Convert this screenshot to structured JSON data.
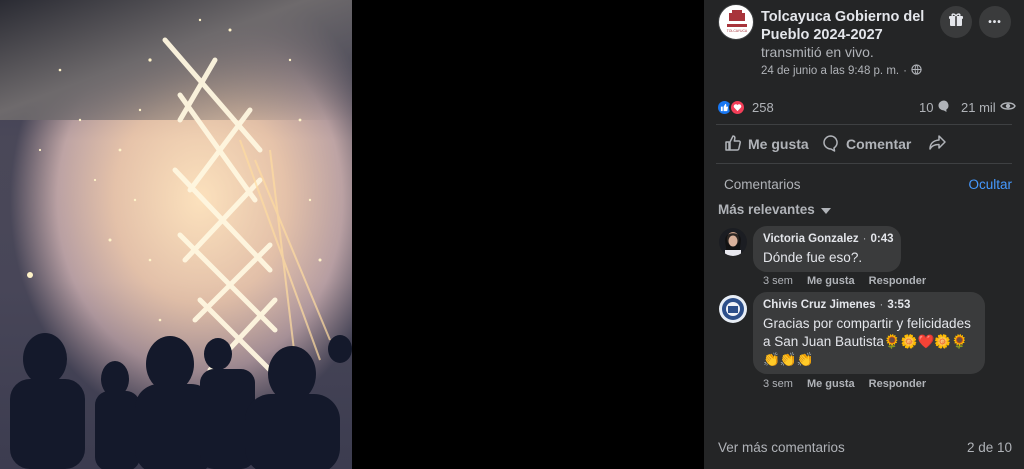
{
  "post": {
    "page_name": "Tolcayuca Gobierno del Pueblo 2024-2027",
    "activity": "transmitió en vivo.",
    "date": "24 de junio a las 9:48 p. m.",
    "meta_separator": "·",
    "privacy_icon": "globe-icon",
    "logo_text": "TOLCAYUCA"
  },
  "header_buttons": [
    {
      "icon": "gift-icon"
    },
    {
      "icon": "more-icon",
      "glyph": "•••"
    }
  ],
  "stats": {
    "reaction_icons": [
      "like-icon",
      "love-icon"
    ],
    "reactions_count": "258",
    "comments_count": "10",
    "views_count": "21 mil"
  },
  "actions": {
    "like": "Me gusta",
    "comment": "Comentar"
  },
  "comments_section": {
    "label": "Comentarios",
    "hide": "Ocultar",
    "sort": "Más relevantes",
    "items": [
      {
        "author": "Victoria Gonzalez",
        "time": "0:43",
        "text": "Dónde fue eso?.",
        "age": "3 sem",
        "like": "Me gusta",
        "reply": "Responder"
      },
      {
        "author": "Chivis Cruz Jimenes",
        "time": "3:53",
        "text": "Gracias por compartir y felicidades a San Juan Bautista🌻🌼❤️🌼🌻👏👏👏",
        "age": "3 sem",
        "like": "Me gusta",
        "reply": "Responder"
      }
    ],
    "more": "Ver más comentarios",
    "pager": "2 de 10"
  },
  "colors": {
    "panel_bg": "#242526",
    "bubble_bg": "#3a3b3c",
    "link": "#4599ff",
    "like_blue": "#1877f2",
    "love_red": "#f33e58"
  }
}
